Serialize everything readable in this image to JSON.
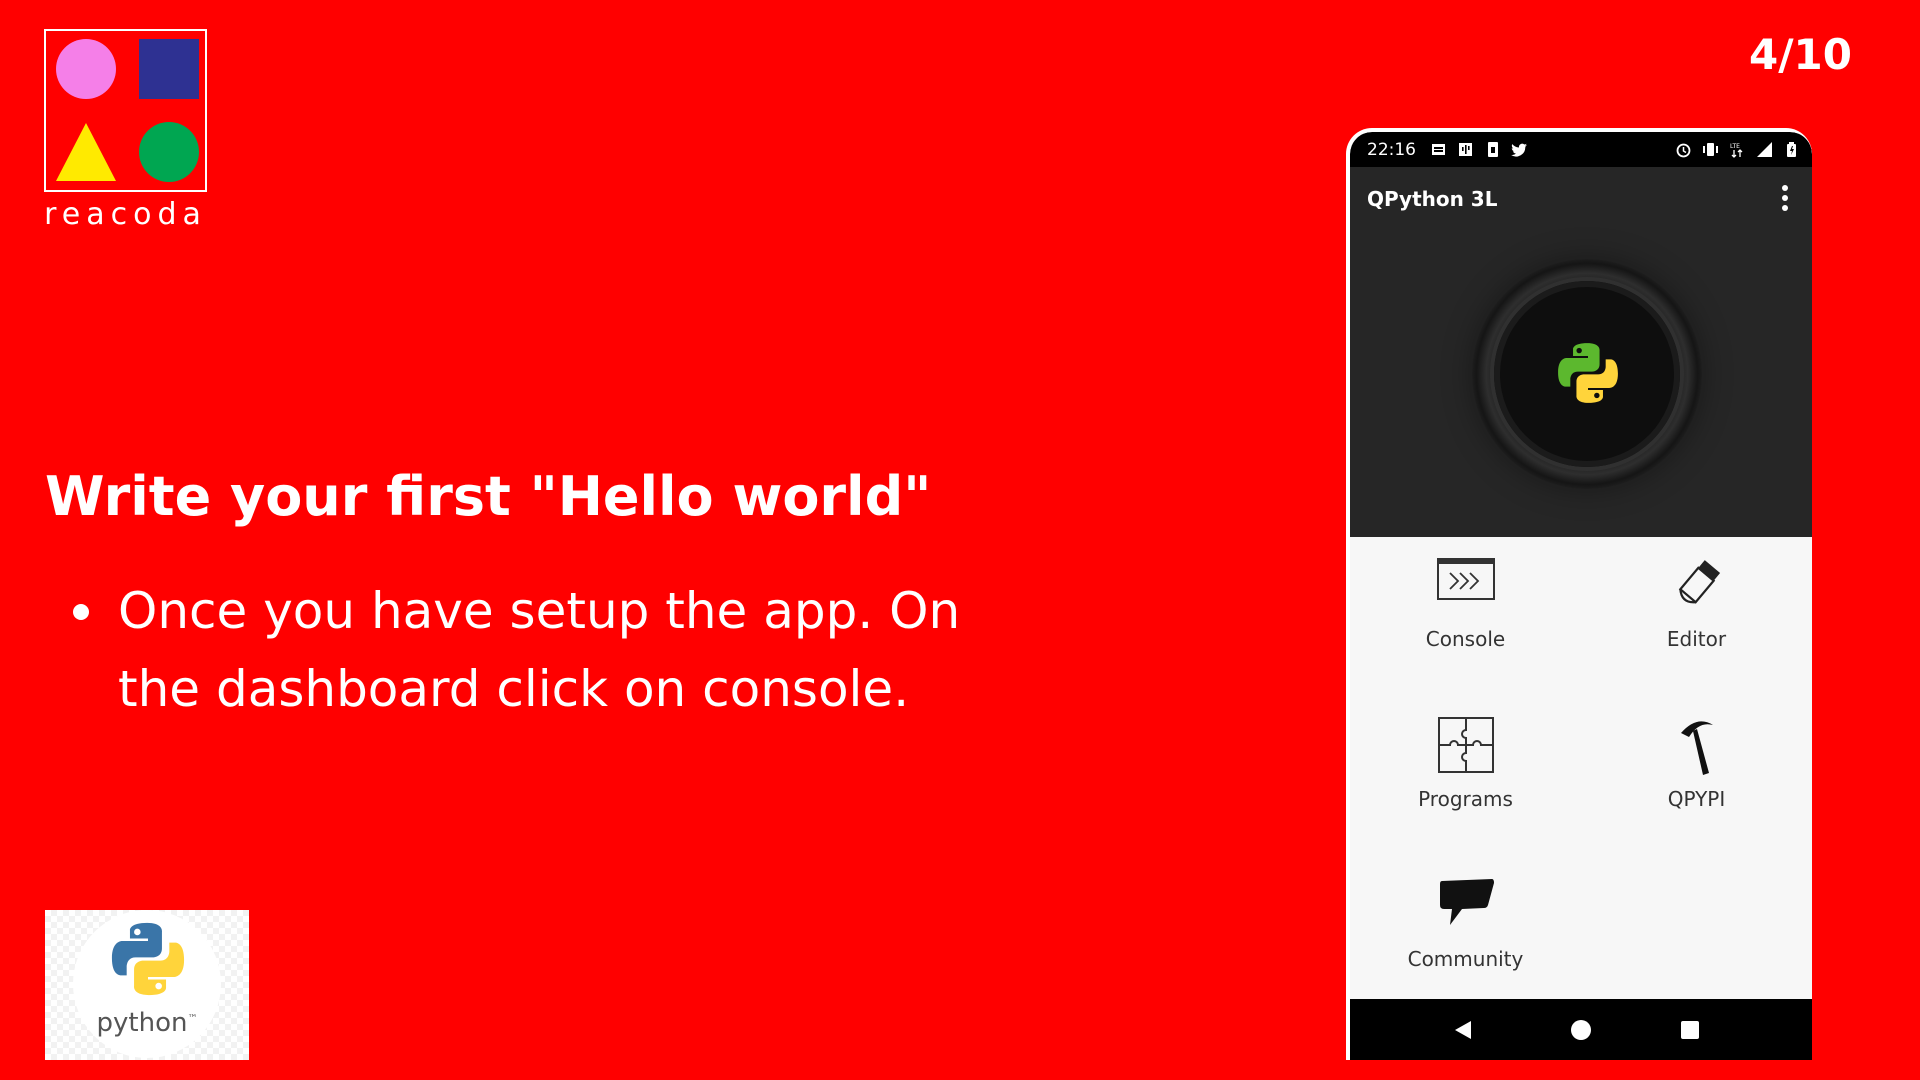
{
  "brand": {
    "name": "reacoda",
    "colors": {
      "background": "#ff0000",
      "circle_pink": "#f57fe8",
      "square_blue": "#2e3192",
      "triangle_yellow": "#ffea00",
      "circle_green": "#00a651"
    }
  },
  "page_indicator": "4/10",
  "slide": {
    "heading": "Write your first \"Hello world\"",
    "bullets": [
      "Once you have setup the app. On the dashboard click on console."
    ]
  },
  "python_badge": {
    "label": "python",
    "trademark": "™",
    "icon": "python-logo-icon"
  },
  "phone": {
    "status_bar": {
      "time": "22:16",
      "left_icons": [
        "notification-icon",
        "usb-icon",
        "sim-icon",
        "twitter-icon"
      ],
      "right_icons": [
        "alarm-icon",
        "vibrate-icon",
        "lte-icon",
        "signal-icon",
        "battery-icon"
      ]
    },
    "app": {
      "title": "QPython 3L",
      "menu_icon": "more-vert-icon",
      "launch_icon": "python-logo-icon"
    },
    "tiles": [
      {
        "label": "Console",
        "icon": "console-icon"
      },
      {
        "label": "Editor",
        "icon": "editor-icon"
      },
      {
        "label": "Programs",
        "icon": "puzzle-icon"
      },
      {
        "label": "QPYPI",
        "icon": "pickaxe-icon"
      },
      {
        "label": "Community",
        "icon": "speech-bubble-icon"
      }
    ],
    "nav": [
      "back-icon",
      "home-icon",
      "recents-icon"
    ]
  }
}
